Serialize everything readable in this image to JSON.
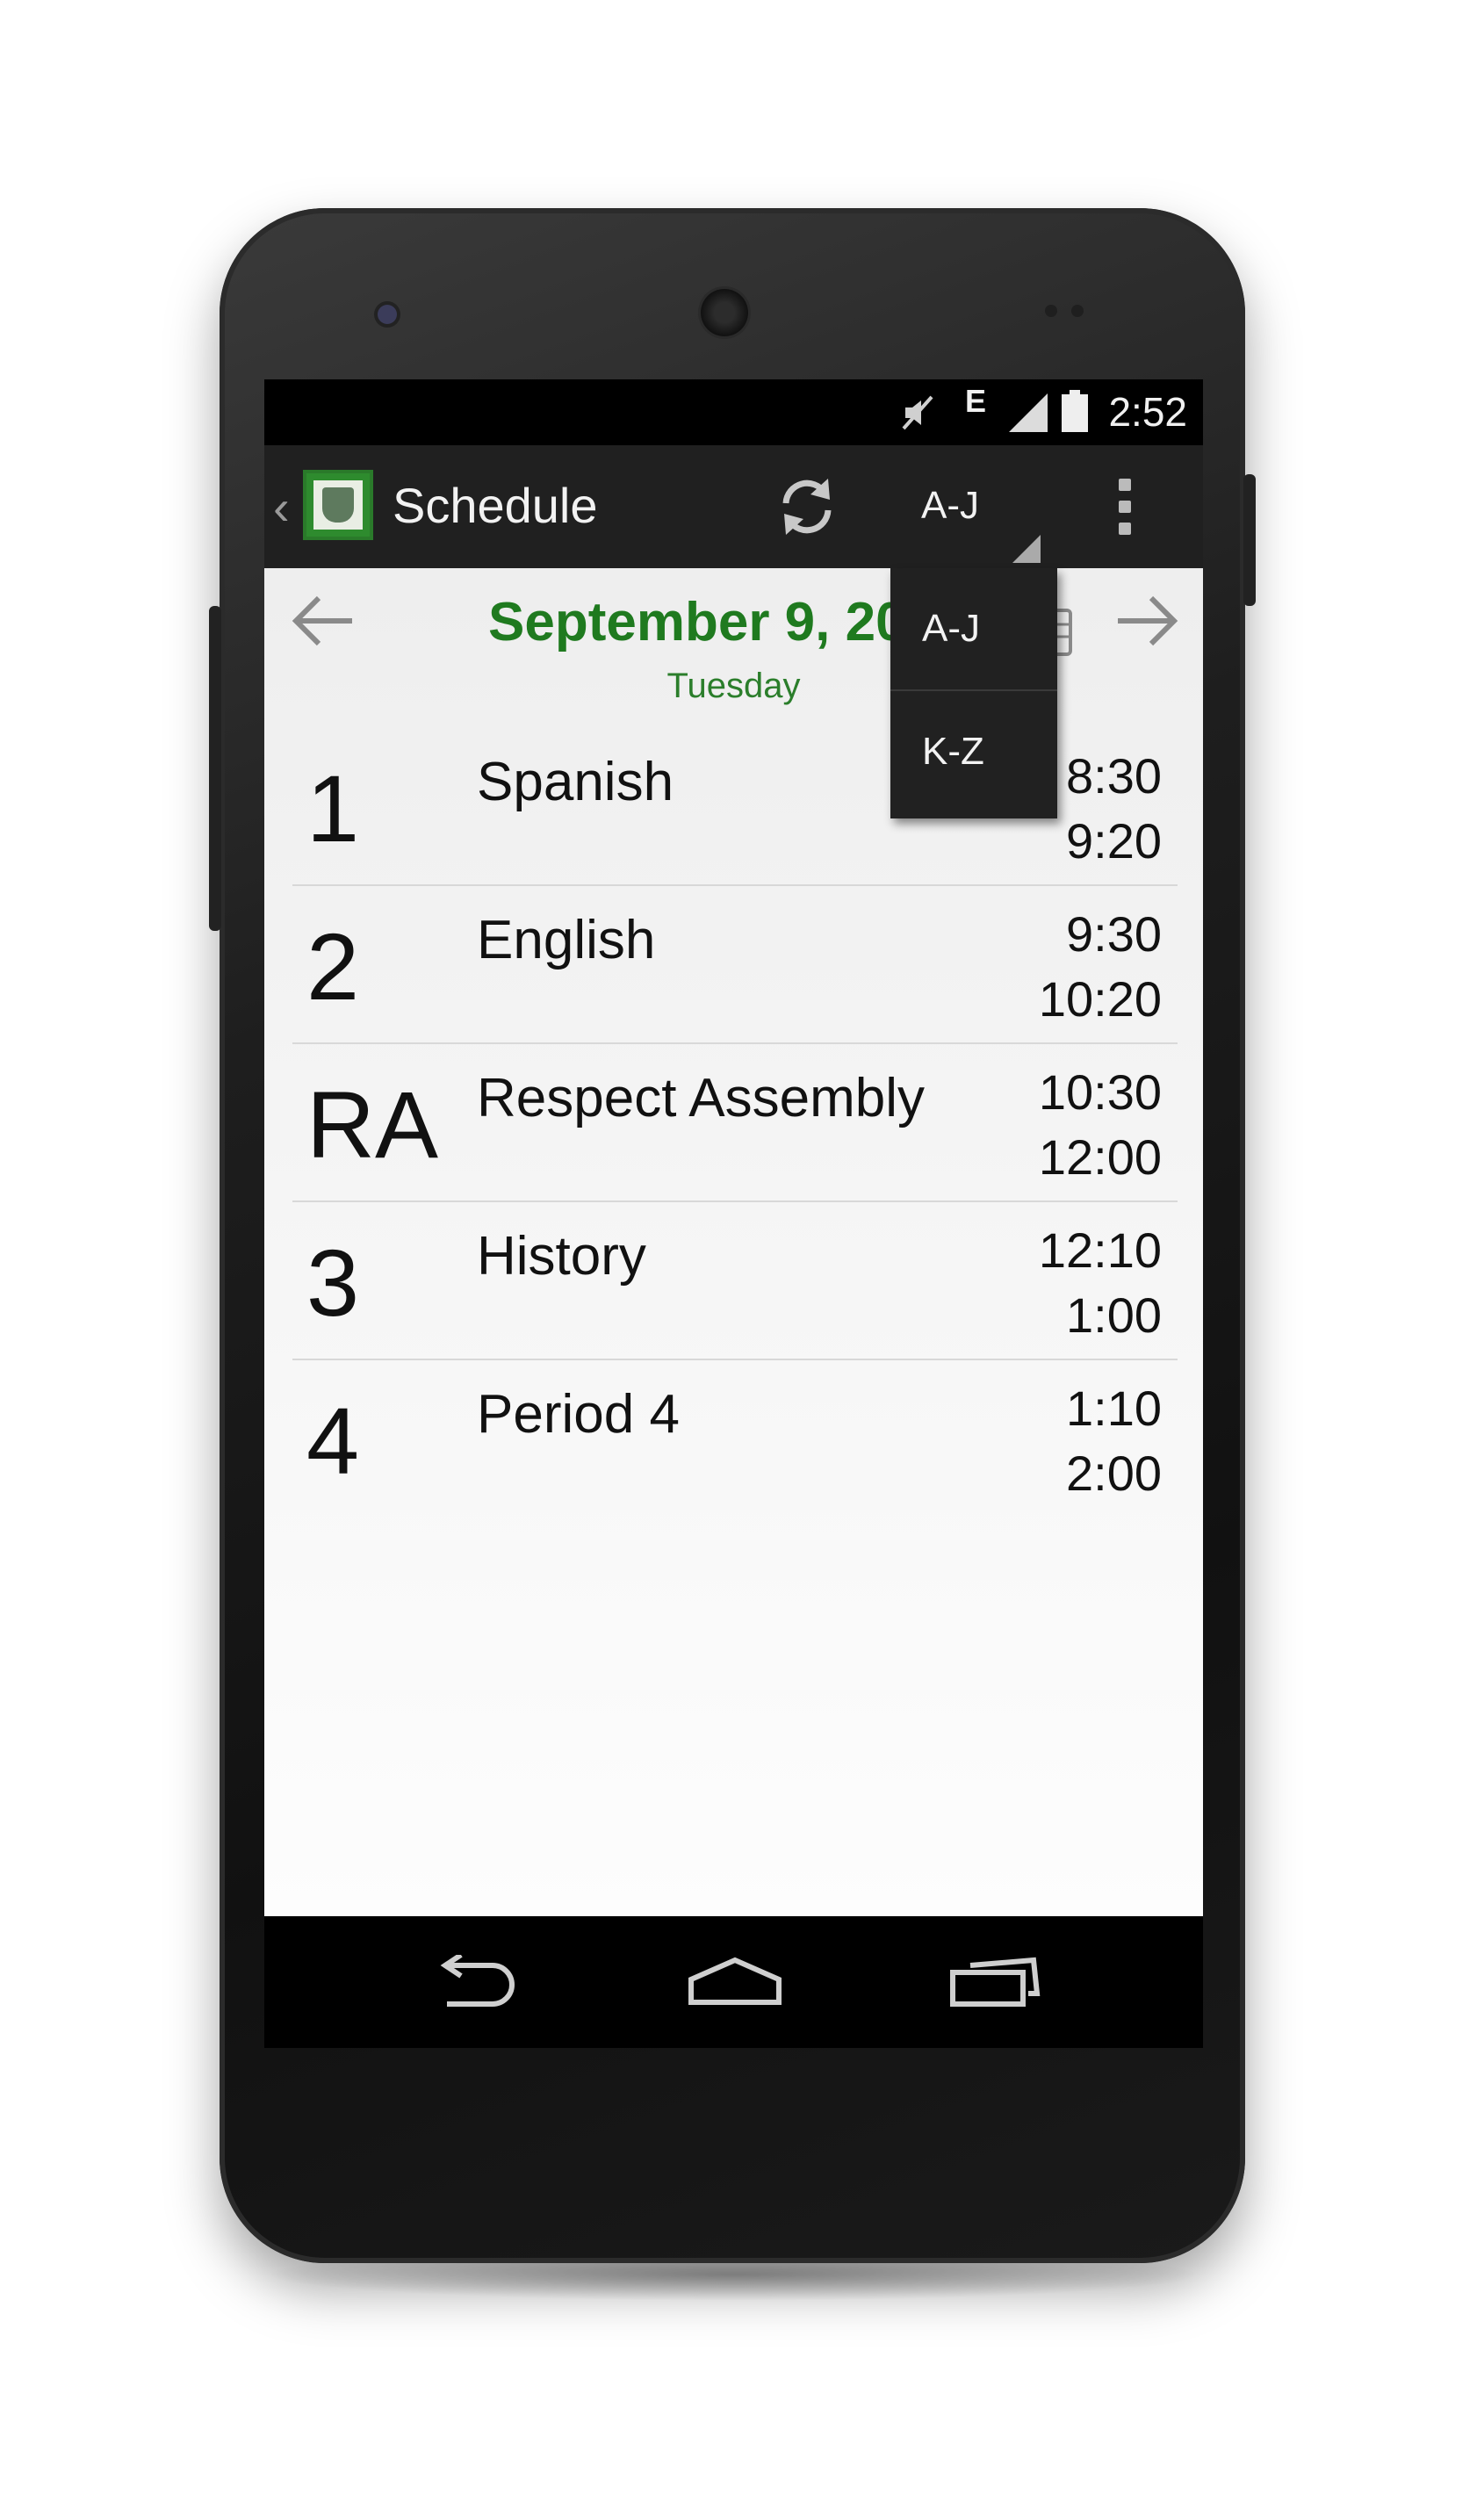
{
  "status_bar": {
    "network_type": "E",
    "time": "2:52",
    "icons": [
      "mute-icon",
      "network-e-icon",
      "signal-icon",
      "battery-icon"
    ]
  },
  "action_bar": {
    "title": "Schedule",
    "spinner_value": "A-J",
    "icons": [
      "up-caret-icon",
      "app-logo-icon",
      "refresh-icon",
      "overflow-menu-icon"
    ]
  },
  "date_header": {
    "date": "September 9, 20",
    "day": "Tuesday",
    "icons": [
      "prev-arrow-icon",
      "calendar-icon",
      "next-arrow-icon"
    ]
  },
  "dropdown": {
    "options": [
      "A-J",
      "K-Z"
    ]
  },
  "schedule": [
    {
      "period": "1",
      "subject": "Spanish",
      "start": "8:30",
      "end": "9:20"
    },
    {
      "period": "2",
      "subject": "English",
      "start": "9:30",
      "end": "10:20"
    },
    {
      "period": "RA",
      "subject": "Respect Assembly",
      "start": "10:30",
      "end": "12:00"
    },
    {
      "period": "3",
      "subject": "History",
      "start": "12:10",
      "end": "1:00"
    },
    {
      "period": "4",
      "subject": "Period 4",
      "start": "1:10",
      "end": "2:00"
    }
  ],
  "nav_bar": {
    "icons": [
      "back-icon",
      "home-icon",
      "recent-apps-icon"
    ]
  },
  "colors": {
    "accent_green": "#1f7a1f",
    "action_bar": "#202020",
    "dropdown_bg": "#212121"
  }
}
